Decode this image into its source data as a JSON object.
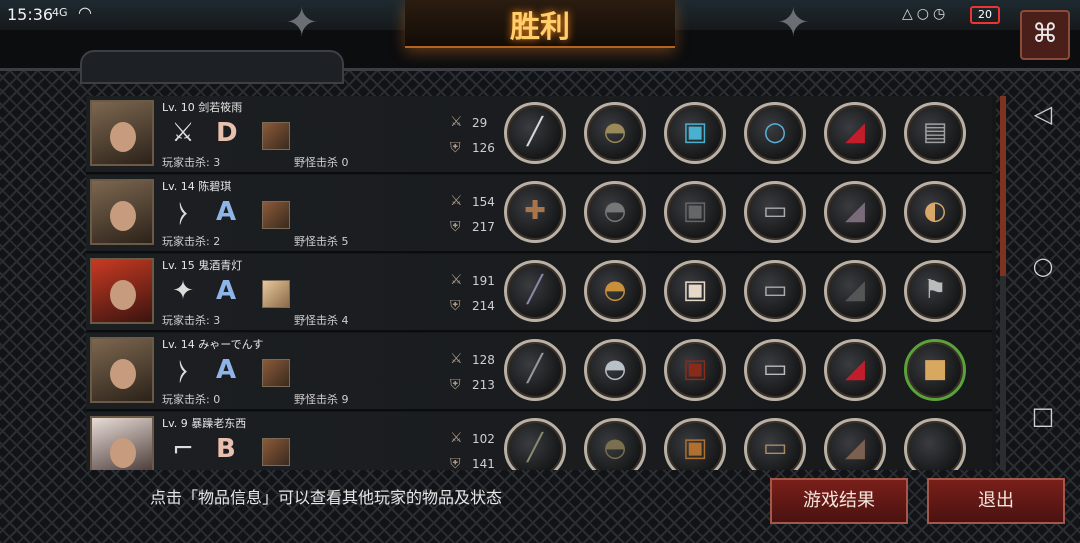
{
  "status_bar": {
    "time": "15:36",
    "signal": "4G",
    "battery": "20"
  },
  "title": "胜利",
  "players": [
    {
      "level": "Lv. 10",
      "name": "剑若筱雨",
      "grade": "D",
      "weapon_icon": "sword-icon",
      "player_kills": "玩家击杀: 3",
      "monster_kills": "野怪击杀 0",
      "attack": "29",
      "defense": "126",
      "items": [
        "brush-weapon-icon",
        "helmet-icon",
        "armor-icon",
        "necklace-icon",
        "boots-icon",
        "bracer-icon"
      ]
    },
    {
      "level": "Lv. 14",
      "name": "陈碧琪",
      "grade": "A",
      "weapon_icon": "bow-icon",
      "player_kills": "玩家击杀: 2",
      "monster_kills": "野怪击杀 5",
      "attack": "154",
      "defense": "217",
      "items": [
        "crossbow-icon",
        "helmet-icon",
        "armor-icon",
        "bracer-icon",
        "boots-icon",
        "fan-icon"
      ]
    },
    {
      "level": "Lv. 15",
      "name": "鬼酒青灯",
      "grade": "A",
      "weapon_icon": "shuriken-icon",
      "player_kills": "玩家击杀: 3",
      "monster_kills": "野怪击杀 4",
      "attack": "191",
      "defense": "214",
      "items": [
        "blade-icon",
        "helmet-icon",
        "armor-icon",
        "bracer-icon",
        "boots-icon",
        "flag-icon"
      ]
    },
    {
      "level": "Lv. 14",
      "name": "みゃーでんす",
      "grade": "A",
      "weapon_icon": "bow-icon",
      "player_kills": "玩家击杀: 0",
      "monster_kills": "野怪击杀 9",
      "attack": "128",
      "defense": "213",
      "items": [
        "bow-item-icon",
        "helmet-icon",
        "armor-icon",
        "bracer-icon",
        "boots-icon",
        "supply-crate-icon"
      ]
    },
    {
      "level": "Lv. 9",
      "name": "暴躁老东西",
      "grade": "B",
      "weapon_icon": "pistol-icon",
      "player_kills": "",
      "monster_kills": "",
      "attack": "102",
      "defense": "141",
      "items": [
        "rifle-icon",
        "helmet-icon",
        "armor-icon",
        "bracer-icon",
        "boots-icon",
        "empty-slot"
      ]
    }
  ],
  "hint": "点击「物品信息」可以查看其他玩家的物品及状态",
  "buttons": {
    "result": "游戏结果",
    "exit": "退出"
  },
  "colors": {
    "accent": "#ffcf6b",
    "button": "#7a1f1a",
    "slot_ring": "#b9b1a6"
  }
}
